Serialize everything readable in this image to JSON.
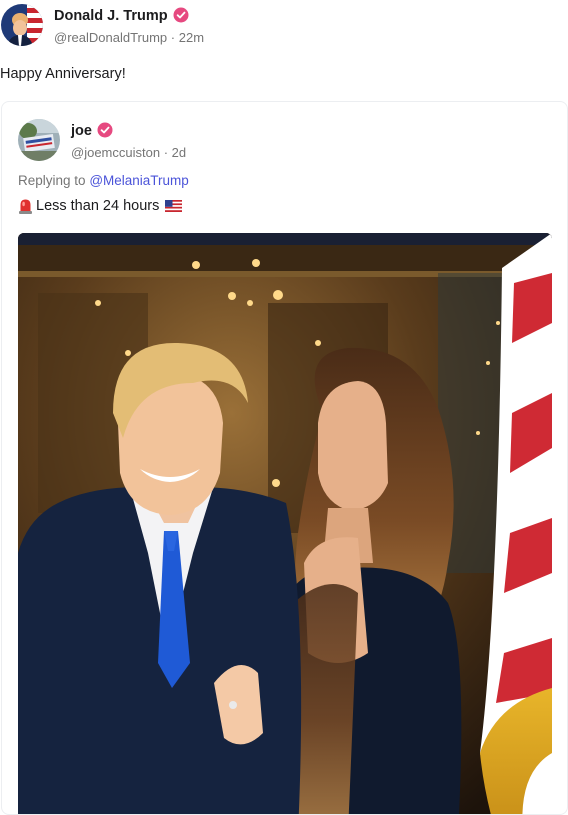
{
  "post": {
    "author_name": "Donald J. Trump",
    "author_handle": "@realDonaldTrump",
    "time_ago": "22m",
    "text": "Happy Anniversary!",
    "verified_icon": "verified-badge-icon",
    "verified_color": "#e64980"
  },
  "quoted_post": {
    "author_name": "joe",
    "author_handle": "@joemccuiston",
    "time_ago": "2d",
    "replying_to_label": "Replying to",
    "replying_to_handle": "@MelaniaTrump",
    "text": "Less than 24 hours",
    "leading_icon": "police-light-icon",
    "trailing_icon": "us-flag-icon"
  },
  "colors": {
    "text_primary": "#1c1c1e",
    "text_secondary": "#757575",
    "mention": "#4b54d9",
    "card_border": "#eceef1"
  }
}
